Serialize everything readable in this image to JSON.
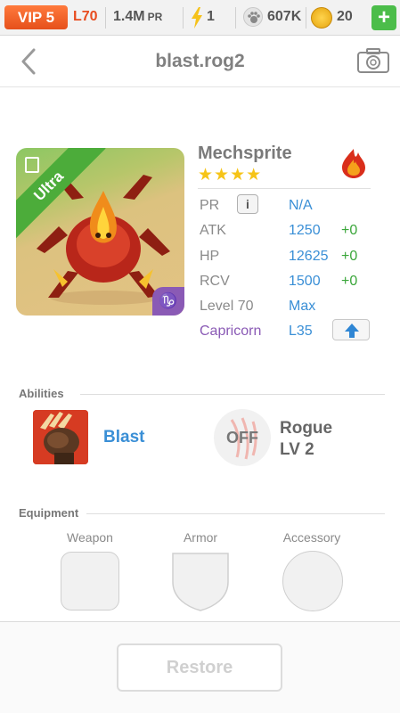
{
  "statusbar": {
    "vip": "VIP 5",
    "level": "L70",
    "power": "1.4M",
    "power_unit": "PR",
    "energy": "1",
    "food": "607K",
    "gold": "20",
    "add_label": "+"
  },
  "header": {
    "title": "blast.rog2",
    "back_icon": "chevron-left-icon",
    "camera_icon": "camera-icon"
  },
  "monster": {
    "rarity": "Ultra",
    "name": "Mechsprite",
    "stars": "★★★★",
    "star_count": 4,
    "element": "fire",
    "zodiac_symbol": "♑",
    "stats": [
      {
        "label": "PR",
        "value": "N/A",
        "bonus": ""
      },
      {
        "label": "ATK",
        "value": "1250",
        "bonus": "+0"
      },
      {
        "label": "HP",
        "value": "12625",
        "bonus": "+0"
      },
      {
        "label": "RCV",
        "value": "1500",
        "bonus": "+0"
      },
      {
        "label": "Level 70",
        "value": "Max",
        "bonus": ""
      }
    ],
    "zodiac": {
      "label": "Capricorn",
      "value": "L35"
    },
    "info_label": "i"
  },
  "abilities": {
    "title": "Abilities",
    "ability_name": "Blast",
    "off_label": "OFF",
    "class_name": "Rogue",
    "class_level": "LV 2"
  },
  "equipment": {
    "title": "Equipment",
    "slots": [
      "Weapon",
      "Armor",
      "Accessory"
    ]
  },
  "footer": {
    "restore_label": "Restore"
  },
  "colors": {
    "accent_blue": "#3a8fd6",
    "bonus_green": "#3aa63a",
    "zodiac_purple": "#8a5ab5",
    "vip_orange": "#e6501b",
    "ultra_green": "#4cac3a"
  }
}
